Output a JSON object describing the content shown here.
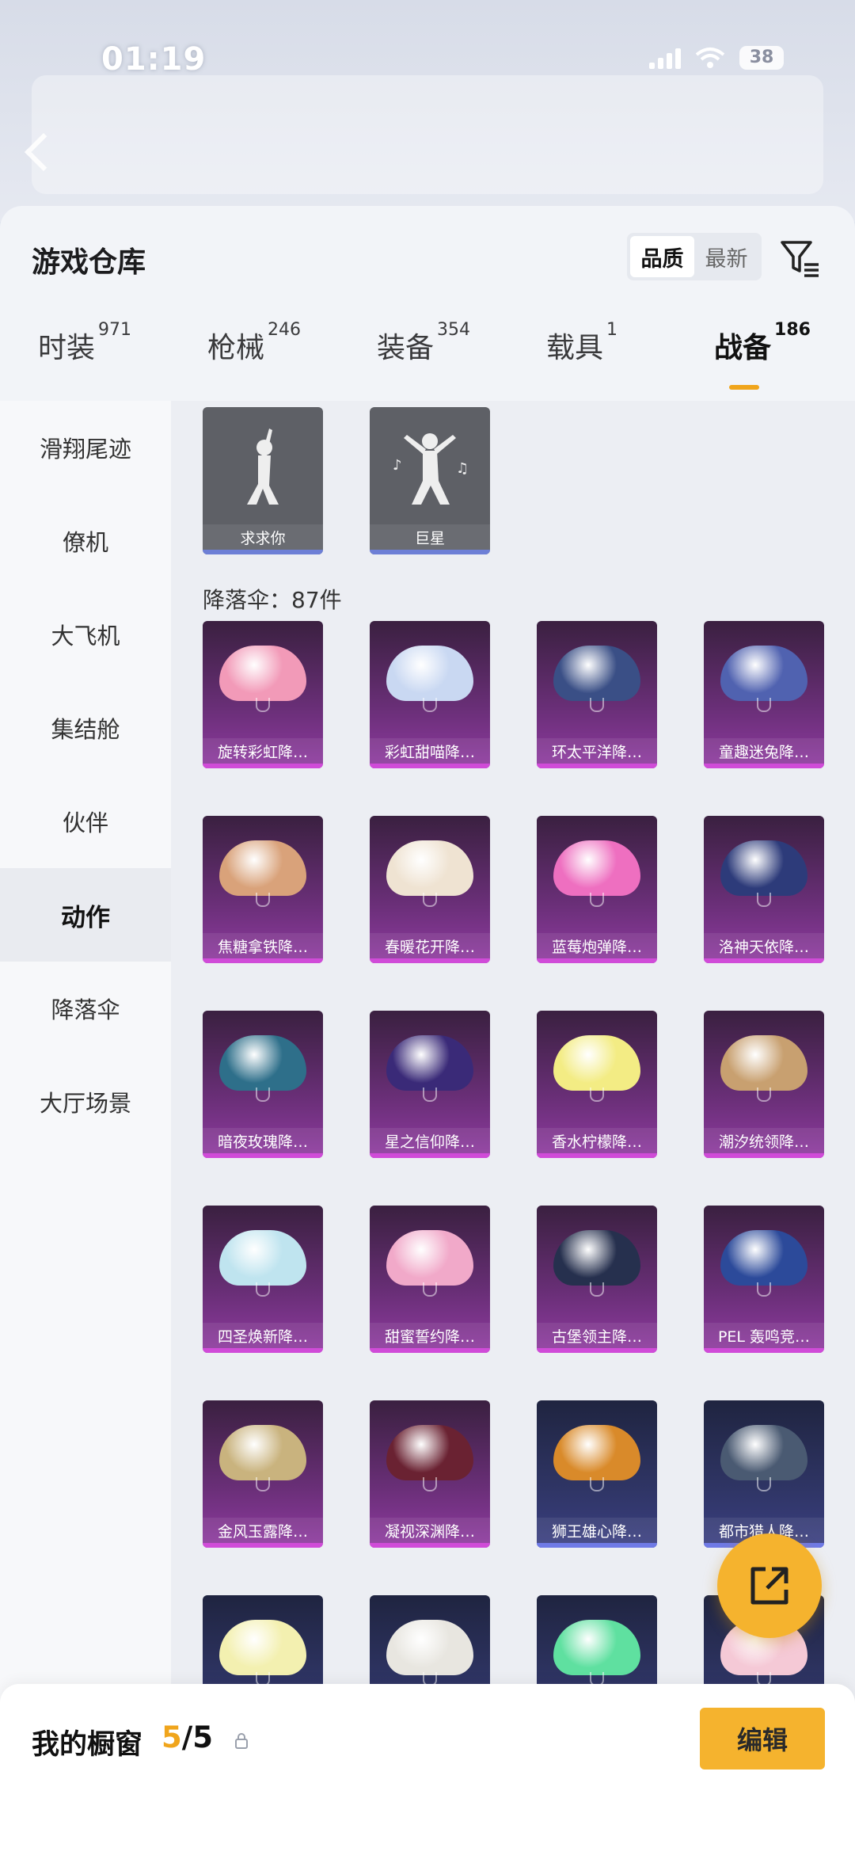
{
  "status_bar": {
    "time": "01:19",
    "battery": "38"
  },
  "header": {
    "title": "游戏仓库",
    "sort_options": [
      "品质",
      "最新"
    ],
    "active_sort": "品质",
    "filter_icon": "filter-icon"
  },
  "tabs": [
    {
      "label": "时装",
      "count": "971",
      "active": false
    },
    {
      "label": "枪械",
      "count": "246",
      "active": false
    },
    {
      "label": "装备",
      "count": "354",
      "active": false
    },
    {
      "label": "载具",
      "count": "1",
      "active": false
    },
    {
      "label": "战备",
      "count": "186",
      "active": true
    }
  ],
  "sidebar": {
    "items": [
      {
        "label": "滑翔尾迹",
        "active": false
      },
      {
        "label": "僚机",
        "active": false
      },
      {
        "label": "大飞机",
        "active": false
      },
      {
        "label": "集结舱",
        "active": false
      },
      {
        "label": "伙伴",
        "active": false
      },
      {
        "label": "动作",
        "active": true
      },
      {
        "label": "降落伞",
        "active": false
      },
      {
        "label": "大厅场景",
        "active": false
      }
    ]
  },
  "emotes": [
    {
      "name": "求求你"
    },
    {
      "name": "巨星"
    }
  ],
  "parachute_section": {
    "label": "降落伞：87件"
  },
  "parachutes": [
    {
      "name": "旋转彩虹降…",
      "rarity": "purple",
      "color": "#f29ab8"
    },
    {
      "name": "彩虹甜喵降…",
      "rarity": "purple",
      "color": "#c9d8f2"
    },
    {
      "name": "环太平洋降…",
      "rarity": "purple",
      "color": "#3a4f86"
    },
    {
      "name": "童趣迷兔降…",
      "rarity": "purple",
      "color": "#5062b0"
    },
    {
      "name": "焦糖拿铁降…",
      "rarity": "purple",
      "color": "#d9a27a"
    },
    {
      "name": "春暖花开降…",
      "rarity": "purple",
      "color": "#efe3d2"
    },
    {
      "name": "蓝莓炮弹降…",
      "rarity": "purple",
      "color": "#ee6fc0"
    },
    {
      "name": "洛神天依降…",
      "rarity": "purple",
      "color": "#2d3b7a"
    },
    {
      "name": "暗夜玫瑰降…",
      "rarity": "purple",
      "color": "#2e6f8a"
    },
    {
      "name": "星之信仰降…",
      "rarity": "purple",
      "color": "#3a2a78"
    },
    {
      "name": "香水柠檬降…",
      "rarity": "purple",
      "color": "#f3ec84"
    },
    {
      "name": "潮汐统领降…",
      "rarity": "purple",
      "color": "#c8a070"
    },
    {
      "name": "四圣焕新降…",
      "rarity": "purple",
      "color": "#bfe4ef"
    },
    {
      "name": "甜蜜誓约降…",
      "rarity": "purple",
      "color": "#f1a9c9"
    },
    {
      "name": "古堡领主降…",
      "rarity": "purple",
      "color": "#26304e"
    },
    {
      "name": "PEL 轰鸣竞…",
      "rarity": "purple",
      "color": "#2c4a9a"
    },
    {
      "name": "金风玉露降…",
      "rarity": "purple",
      "color": "#c9b37e"
    },
    {
      "name": "凝视深渊降…",
      "rarity": "purple",
      "color": "#6a2232"
    },
    {
      "name": "狮王雄心降…",
      "rarity": "blue",
      "color": "#d98a2a"
    },
    {
      "name": "都市猎人降…",
      "rarity": "blue",
      "color": "#4a5a72"
    },
    {
      "name": "",
      "rarity": "blue",
      "color": "#f3f0b0"
    },
    {
      "name": "",
      "rarity": "blue",
      "color": "#e8e6e0"
    },
    {
      "name": "",
      "rarity": "blue",
      "color": "#5fe0a0"
    },
    {
      "name": "",
      "rarity": "blue",
      "color": "#f5c9d6"
    }
  ],
  "showcase": {
    "label": "我的橱窗",
    "current": "5",
    "total": "/5"
  },
  "edit_label": "编辑",
  "colors": {
    "accent": "#f5b32e",
    "purple_bar": "#d04bd8",
    "blue_bar": "#6f7ae6"
  }
}
